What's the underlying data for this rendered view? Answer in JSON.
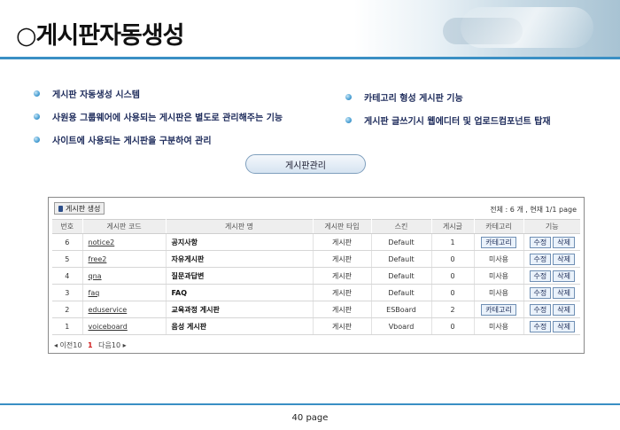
{
  "header": {
    "title": "○게시판자동생성"
  },
  "bullets": {
    "left": [
      "게시판 자동생성 시스템",
      "사원용 그룹웨어에 사용되는 게시판은 별도로 관리해주는 기능",
      "사이트에 사용되는 게시판을 구분하여 관리"
    ],
    "right": [
      "카테고리 형성 게시판 기능",
      "게시판 글쓰기시 웹에디터 및 업로드컴포넌트 탑재"
    ]
  },
  "manage_button": "게시판관리",
  "panel": {
    "generate_button": "게시판 생성",
    "summary": "전체 : 6 개 , 현재 1/1 page",
    "columns": [
      "번호",
      "게시판 코드",
      "게시판 명",
      "게시판 타입",
      "스킨",
      "게시글",
      "카테고리",
      "기능"
    ],
    "rows": [
      {
        "no": "6",
        "code": "notice2",
        "name": "공지사항",
        "type": "게시판",
        "skin": "Default",
        "posts": "1",
        "category": "카테고리",
        "category_button": true
      },
      {
        "no": "5",
        "code": "free2",
        "name": "자유게시판",
        "type": "게시판",
        "skin": "Default",
        "posts": "0",
        "category": "미사용",
        "category_button": false
      },
      {
        "no": "4",
        "code": "qna",
        "name": "질문과답변",
        "type": "게시판",
        "skin": "Default",
        "posts": "0",
        "category": "미사용",
        "category_button": false
      },
      {
        "no": "3",
        "code": "faq",
        "name": "FAQ",
        "type": "게시판",
        "skin": "Default",
        "posts": "0",
        "category": "미사용",
        "category_button": false
      },
      {
        "no": "2",
        "code": "eduservice",
        "name": "교육과정 게시판",
        "type": "게시판",
        "skin": "ESBoard",
        "posts": "2",
        "category": "카테고리",
        "category_button": true
      },
      {
        "no": "1",
        "code": "voiceboard",
        "name": "음성 게시판",
        "type": "게시판",
        "skin": "Vboard",
        "posts": "0",
        "category": "미사용",
        "category_button": false
      }
    ],
    "edit_label": "수정",
    "delete_label": "삭제",
    "pager": {
      "prev": "◂ 이전10",
      "current": "1",
      "next": "다음10 ▸"
    }
  },
  "footer": {
    "page": "40 page"
  },
  "colors": {
    "accent": "#3a8fc4",
    "button_border": "#6f8fb4",
    "current_page": "#d02020"
  }
}
